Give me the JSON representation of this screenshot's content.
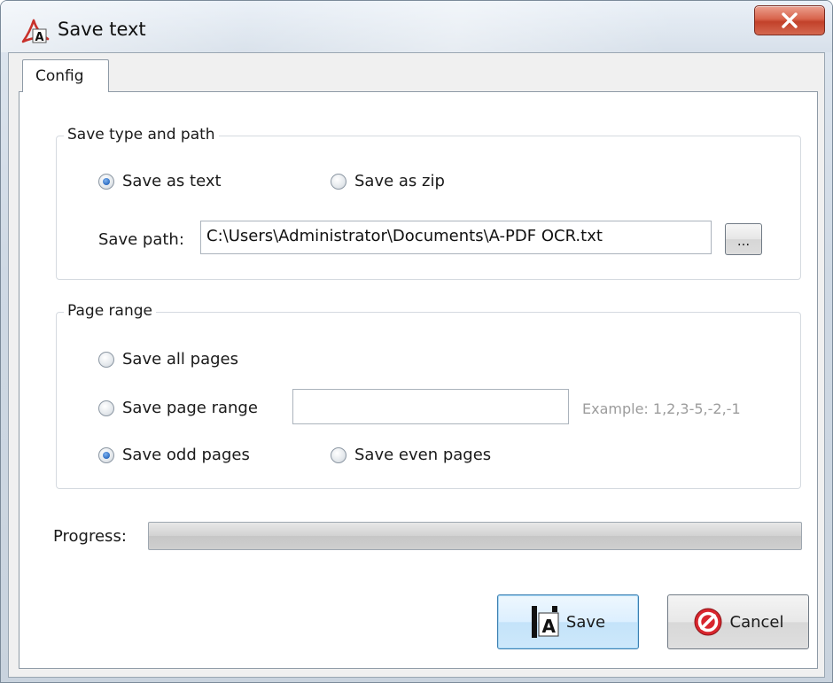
{
  "window": {
    "title": "Save text",
    "close_glyph": "x"
  },
  "tabs": [
    {
      "label": "Config",
      "selected": true
    }
  ],
  "save_group": {
    "title": "Save type and path",
    "options": [
      {
        "label": "Save as text",
        "checked": true
      },
      {
        "label": "Save as zip",
        "checked": false
      }
    ],
    "path_label": "Save path:",
    "path_value": "C:\\Users\\Administrator\\Documents\\A-PDF OCR.txt",
    "browse_label": "..."
  },
  "range_group": {
    "title": "Page range",
    "options": {
      "all": {
        "label": "Save all pages",
        "checked": false
      },
      "range": {
        "label": "Save page range",
        "checked": false
      },
      "odd": {
        "label": "Save odd pages",
        "checked": true
      },
      "even": {
        "label": "Save even pages",
        "checked": false
      }
    },
    "range_value": "",
    "example": "Example: 1,2,3-5,-2,-1"
  },
  "progress": {
    "label": "Progress:",
    "percent": 0
  },
  "buttons": {
    "save": "Save",
    "cancel": "Cancel"
  },
  "colors": {
    "radio_checked": "#2d6cc2",
    "close_button": "#c2412a",
    "cancel_icon": "#d8262e",
    "hint_text": "#9c9c9c"
  },
  "icons": {
    "app": "a-pdf-logo-icon",
    "close": "close-icon",
    "save": "save-doc-icon",
    "cancel": "cancel-icon"
  }
}
